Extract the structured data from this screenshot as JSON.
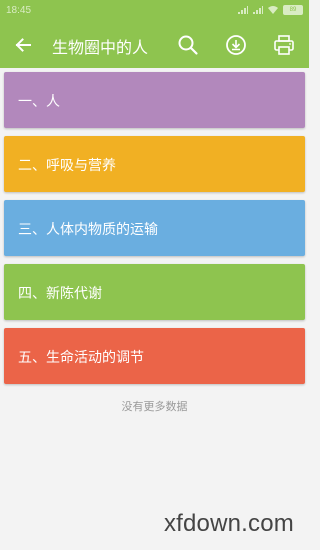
{
  "status_bar": {
    "time": "18:45",
    "battery": "89"
  },
  "toolbar": {
    "title": "生物圈中的人",
    "back_icon": "arrow-left-icon",
    "search_icon": "search-icon",
    "download_icon": "download-circle-icon",
    "print_icon": "print-icon",
    "color": "#8ec44f"
  },
  "chapters": [
    {
      "label": "一、人",
      "color": "#b288bc"
    },
    {
      "label": "二、呼吸与营养",
      "color": "#f1b023"
    },
    {
      "label": "三、人体内物质的运输",
      "color": "#6aaee0"
    },
    {
      "label": "四、新陈代谢",
      "color": "#8ec44f"
    },
    {
      "label": "五、生命活动的调节",
      "color": "#eb6448"
    }
  ],
  "footer_note": "没有更多数据",
  "watermark": "xfdown.com"
}
